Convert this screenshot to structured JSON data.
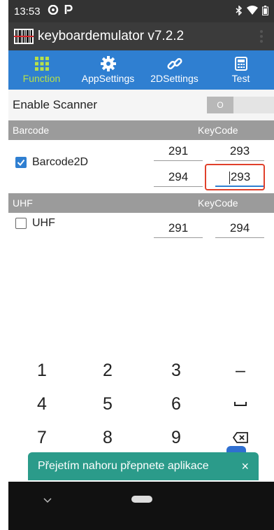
{
  "status": {
    "time": "13:53",
    "icons": [
      "cast-icon",
      "parking-icon"
    ],
    "right_icons": [
      "bluetooth-icon",
      "wifi-icon",
      "battery-icon"
    ]
  },
  "app": {
    "title": "keyboardemulator v7.2.2"
  },
  "tabs": [
    {
      "label": "Function",
      "icon": "grid-icon",
      "active": true
    },
    {
      "label": "AppSettings",
      "icon": "gear-icon",
      "active": false
    },
    {
      "label": "2DSettings",
      "icon": "link-icon",
      "active": false
    },
    {
      "label": "Test",
      "icon": "calculator-icon",
      "active": false
    }
  ],
  "enable_scanner": {
    "label": "Enable Scanner",
    "toggle_text": "O"
  },
  "barcode_section": {
    "title": "Barcode",
    "keycode_header": "KeyCode"
  },
  "barcode": {
    "label": "Barcode2D",
    "checked": true,
    "codes": [
      "291",
      "293",
      "294",
      "293"
    ]
  },
  "uhf_section": {
    "title": "UHF",
    "keycode_header": "KeyCode"
  },
  "uhf": {
    "label": "UHF",
    "checked": false,
    "codes": [
      "291",
      "294"
    ]
  },
  "keypad": {
    "keys": [
      "1",
      "2",
      "3",
      "–",
      "4",
      "5",
      "6",
      "␣",
      "7",
      "8",
      "9",
      "⌫"
    ]
  },
  "toast": {
    "text": "Přejetím nahoru přepnete aplikace",
    "close": "×"
  },
  "colors": {
    "tab_bar": "#2f7fd1",
    "active_tab": "#b6e04a",
    "toast": "#2b9b8a",
    "highlight": "#e0402b"
  }
}
